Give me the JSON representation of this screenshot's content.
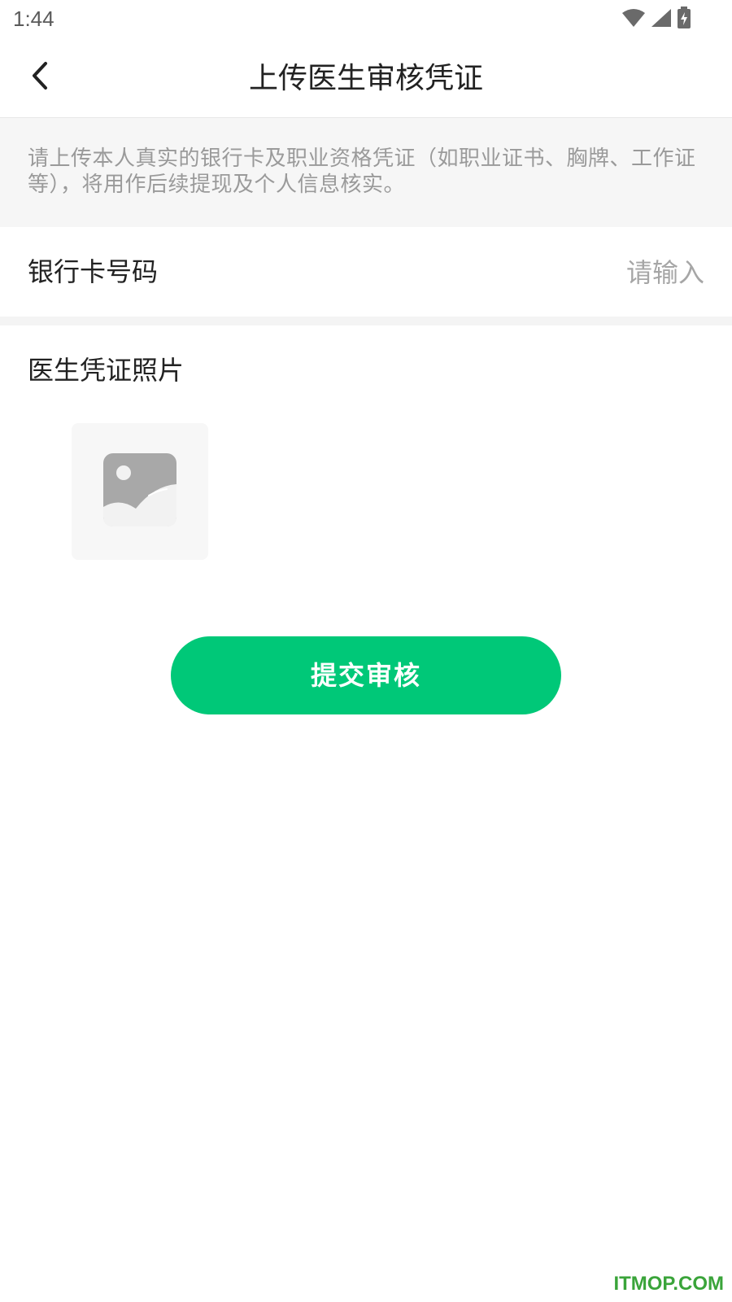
{
  "status_bar": {
    "time": "1:44",
    "icons": [
      "wifi-icon",
      "cell-signal-icon",
      "battery-charging-icon"
    ]
  },
  "header": {
    "title": "上传医生审核凭证",
    "back_icon": "chevron-left-icon"
  },
  "notice": {
    "text": "请上传本人真实的银行卡及职业资格凭证（如职业证书、胸牌、工作证等），将用作后续提现及个人信息核实。"
  },
  "bank_card": {
    "label": "银行卡号码",
    "value": "",
    "placeholder": "请输入"
  },
  "photo": {
    "label": "医生凭证照片",
    "upload_icon": "image-placeholder-icon"
  },
  "submit": {
    "label": "提交审核"
  },
  "watermark": {
    "text": "ITMOP.COM"
  },
  "colors": {
    "accent": "#00c878",
    "notice_bg": "#f6f6f6",
    "notice_text": "#9a9a9a",
    "title_text": "#222222",
    "watermark": "#3aa43a"
  }
}
